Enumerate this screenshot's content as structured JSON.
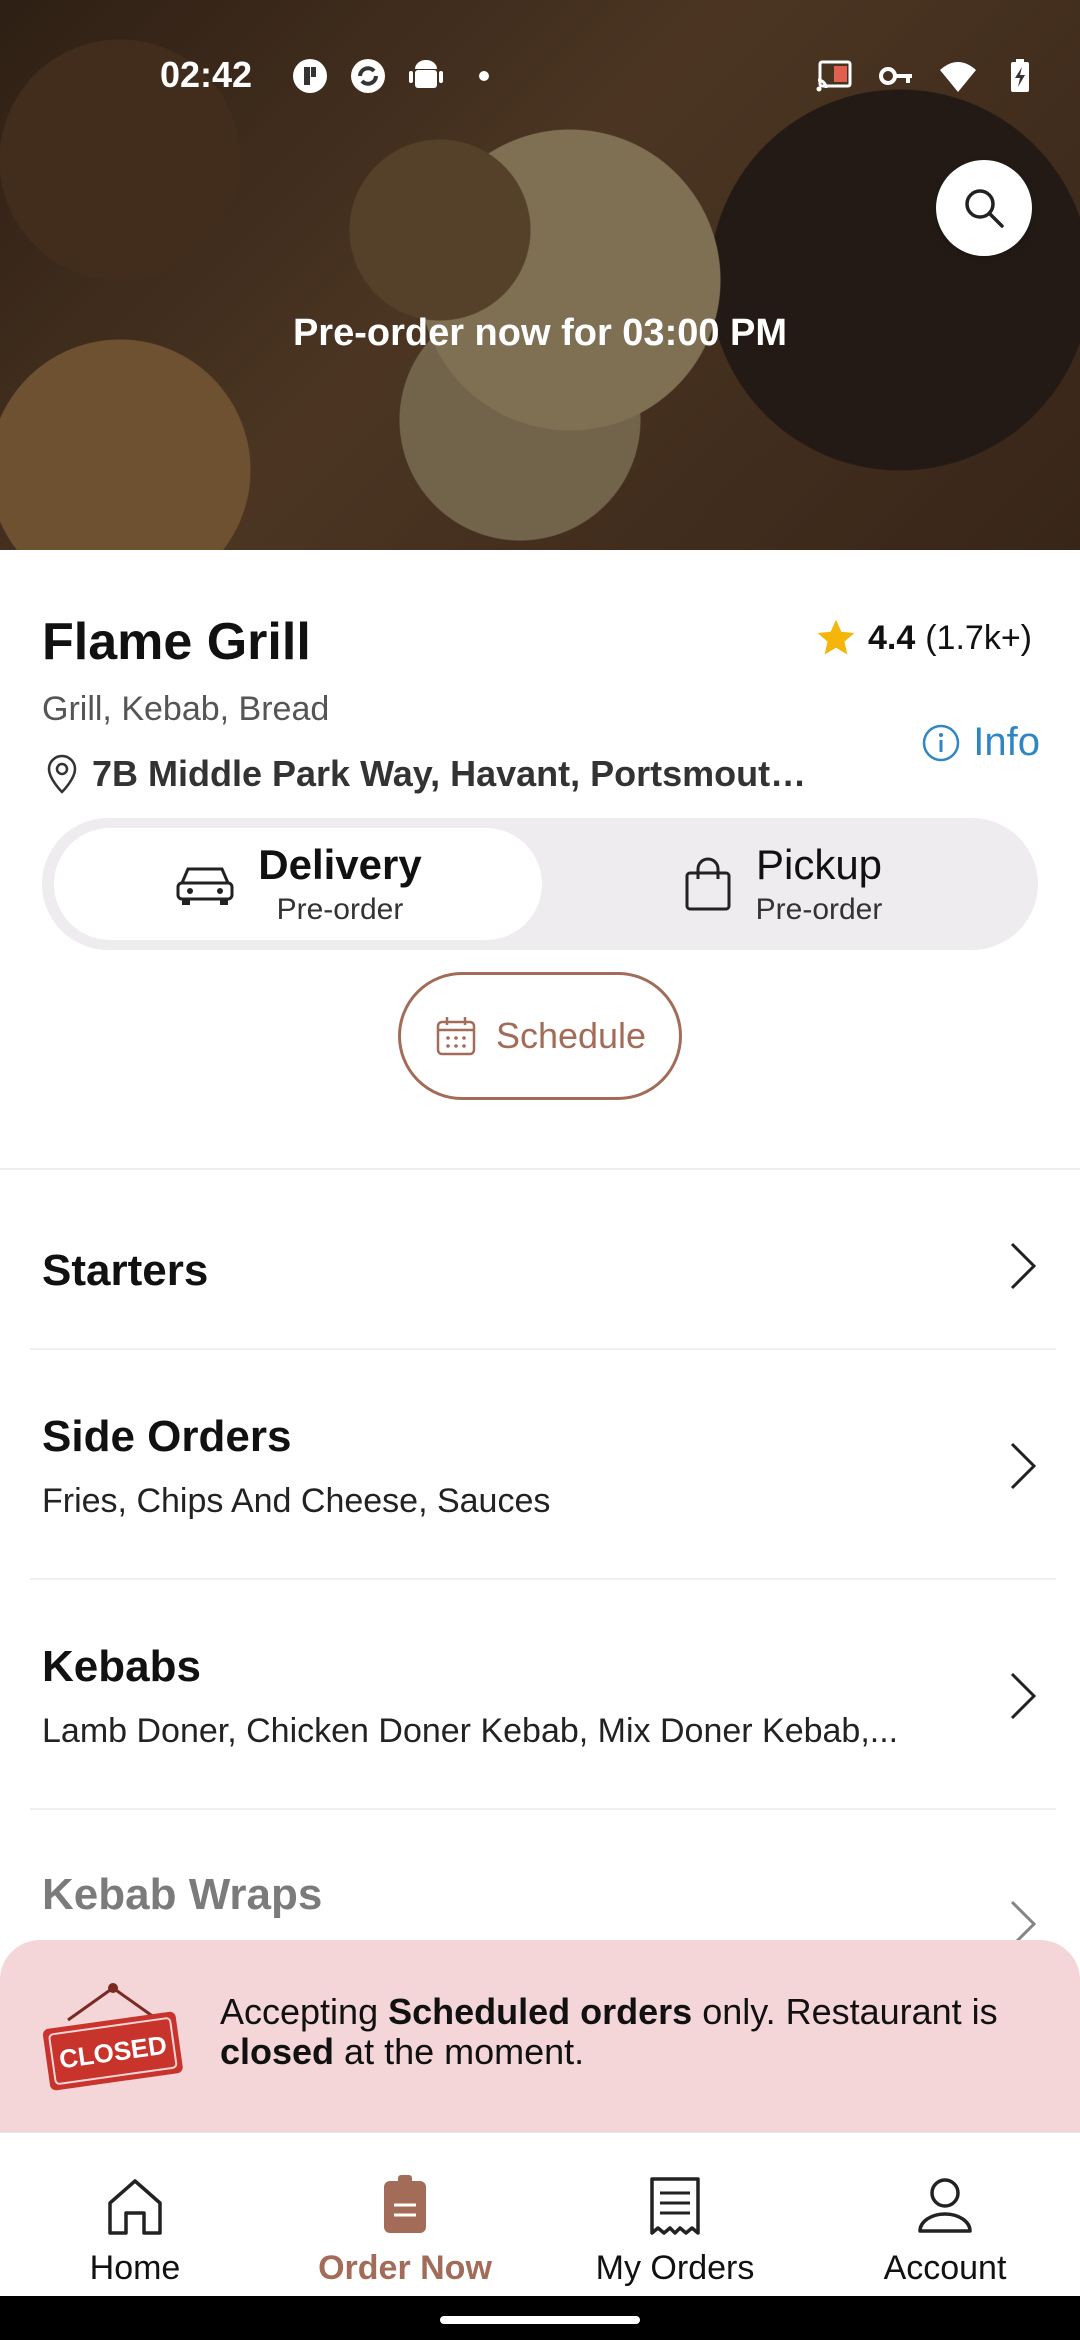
{
  "status": {
    "time": "02:42"
  },
  "hero": {
    "preorder_text": "Pre-order now for 03:00 PM"
  },
  "restaurant": {
    "name": "Flame Grill",
    "rating": "4.4",
    "rating_count": "(1.7k+)",
    "cuisines": "Grill, Kebab, Bread",
    "address": "7B Middle Park Way, Havant, Portsmout…",
    "info_label": "Info"
  },
  "modes": {
    "delivery": {
      "title": "Delivery",
      "sub": "Pre-order",
      "selected": true
    },
    "pickup": {
      "title": "Pickup",
      "sub": "Pre-order",
      "selected": false
    }
  },
  "schedule_label": "Schedule",
  "categories": [
    {
      "name": "Starters",
      "desc": ""
    },
    {
      "name": "Side Orders",
      "desc": "Fries, Chips And Cheese, Sauces"
    },
    {
      "name": "Kebabs",
      "desc": "Lamb Doner, Chicken Doner Kebab, Mix Doner Kebab,..."
    },
    {
      "name": "Kebab Wraps",
      "desc": ""
    }
  ],
  "closed_notice": {
    "sign_text": "CLOSED",
    "part1": "Accepting ",
    "bold1": "Scheduled orders",
    "part2": " only. Restaurant is ",
    "bold2": "closed",
    "part3": " at the moment."
  },
  "nav": [
    {
      "label": "Home",
      "icon": "home-icon",
      "active": false
    },
    {
      "label": "Order Now",
      "icon": "order-icon",
      "active": true
    },
    {
      "label": "My Orders",
      "icon": "receipt-icon",
      "active": false
    },
    {
      "label": "Account",
      "icon": "person-icon",
      "active": false
    }
  ],
  "colors": {
    "accent": "#a36c59",
    "info": "#2f86c4",
    "closed_bg": "#f4d5d8",
    "star": "#f5b50a"
  }
}
